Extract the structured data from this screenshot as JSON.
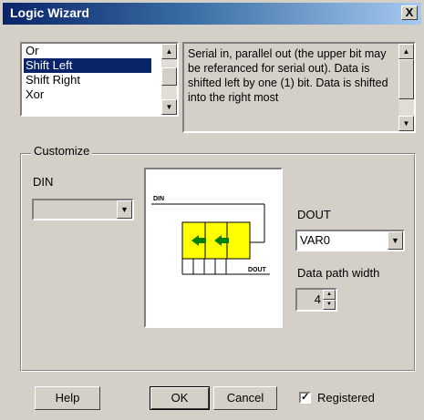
{
  "window": {
    "title": "Logic Wizard",
    "close_glyph": "X"
  },
  "function_list": {
    "items": [
      "Or",
      "Shift Left",
      "Shift Right",
      "Xor"
    ],
    "selected": "Shift Left"
  },
  "description": {
    "text": "Serial in, parallel out (the upper bit may be referanced for serial out). Data is shifted left by one (1) bit. Data is shifted into the right most"
  },
  "customize": {
    "group_label": "Customize",
    "din_label": "DIN",
    "din_value": "",
    "dout_label": "DOUT",
    "dout_value": "VAR0",
    "data_path_label": "Data path width",
    "data_path_value": "4",
    "diagram": {
      "din_text": "DIN",
      "dout_text": "DOUT"
    }
  },
  "buttons": {
    "help": "Help",
    "ok": "OK",
    "cancel": "Cancel",
    "registered_label": "Registered",
    "registered_checked": true
  },
  "icons": {
    "close": "close-icon",
    "scroll_up": "arrow-up-icon",
    "scroll_down": "arrow-down-icon",
    "dropdown": "chevron-down-icon"
  },
  "colors": {
    "title_start": "#0a246a",
    "title_end": "#a6caf0",
    "face": "#d4d0c8",
    "selection": "#0a246a",
    "register_fill": "#ffff00",
    "arrow": "#008000"
  }
}
